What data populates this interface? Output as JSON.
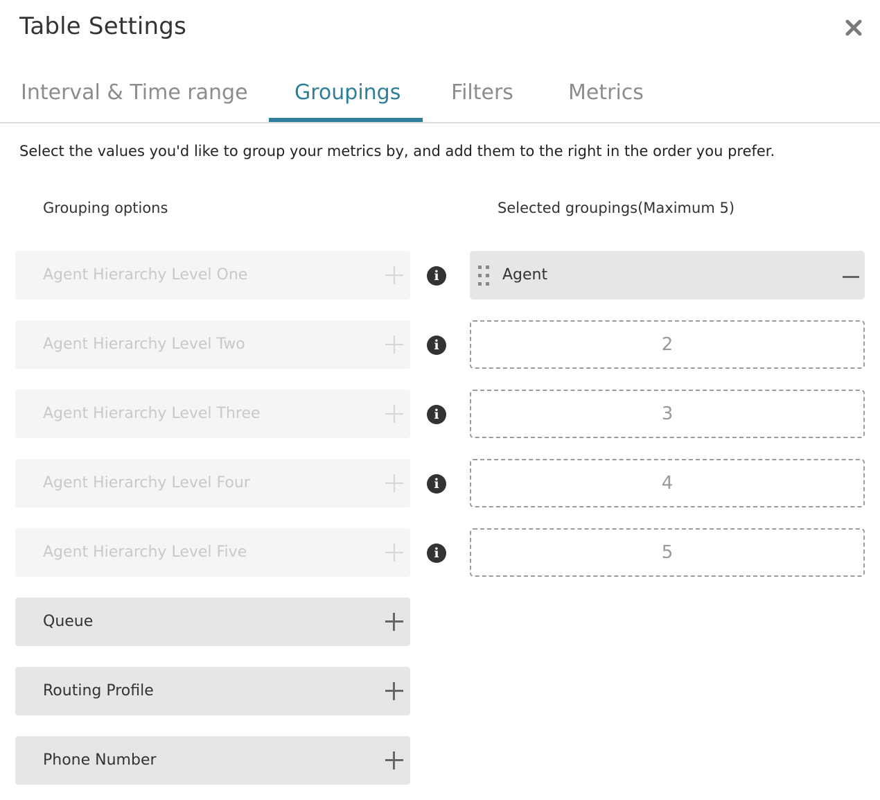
{
  "dialog": {
    "title": "Table Settings",
    "close_icon": "close-icon"
  },
  "tabs": [
    {
      "label": "Interval & Time range"
    },
    {
      "label": "Groupings",
      "active": true
    },
    {
      "label": "Filters"
    },
    {
      "label": "Metrics"
    }
  ],
  "description": "Select the values you'd like to group your metrics by, and add them to the right in the order you prefer.",
  "grouping_options": {
    "heading": "Grouping options",
    "items": [
      {
        "label": "Agent Hierarchy Level One",
        "enabled": false
      },
      {
        "label": "Agent Hierarchy Level Two",
        "enabled": false
      },
      {
        "label": "Agent Hierarchy Level Three",
        "enabled": false
      },
      {
        "label": "Agent Hierarchy Level Four",
        "enabled": false
      },
      {
        "label": "Agent Hierarchy Level Five",
        "enabled": false
      },
      {
        "label": "Queue",
        "enabled": true
      },
      {
        "label": "Routing Profile",
        "enabled": true
      },
      {
        "label": "Phone Number",
        "enabled": true
      }
    ]
  },
  "selected_groupings": {
    "heading": "Selected groupings(Maximum 5)",
    "items": [
      {
        "label": "Agent"
      },
      {
        "slot": "2"
      },
      {
        "slot": "3"
      },
      {
        "slot": "4"
      },
      {
        "slot": "5"
      }
    ]
  },
  "colors": {
    "accent": "#2e7f97",
    "disabled_text": "#c9c9c9",
    "option_bg": "#e6e6e6"
  }
}
